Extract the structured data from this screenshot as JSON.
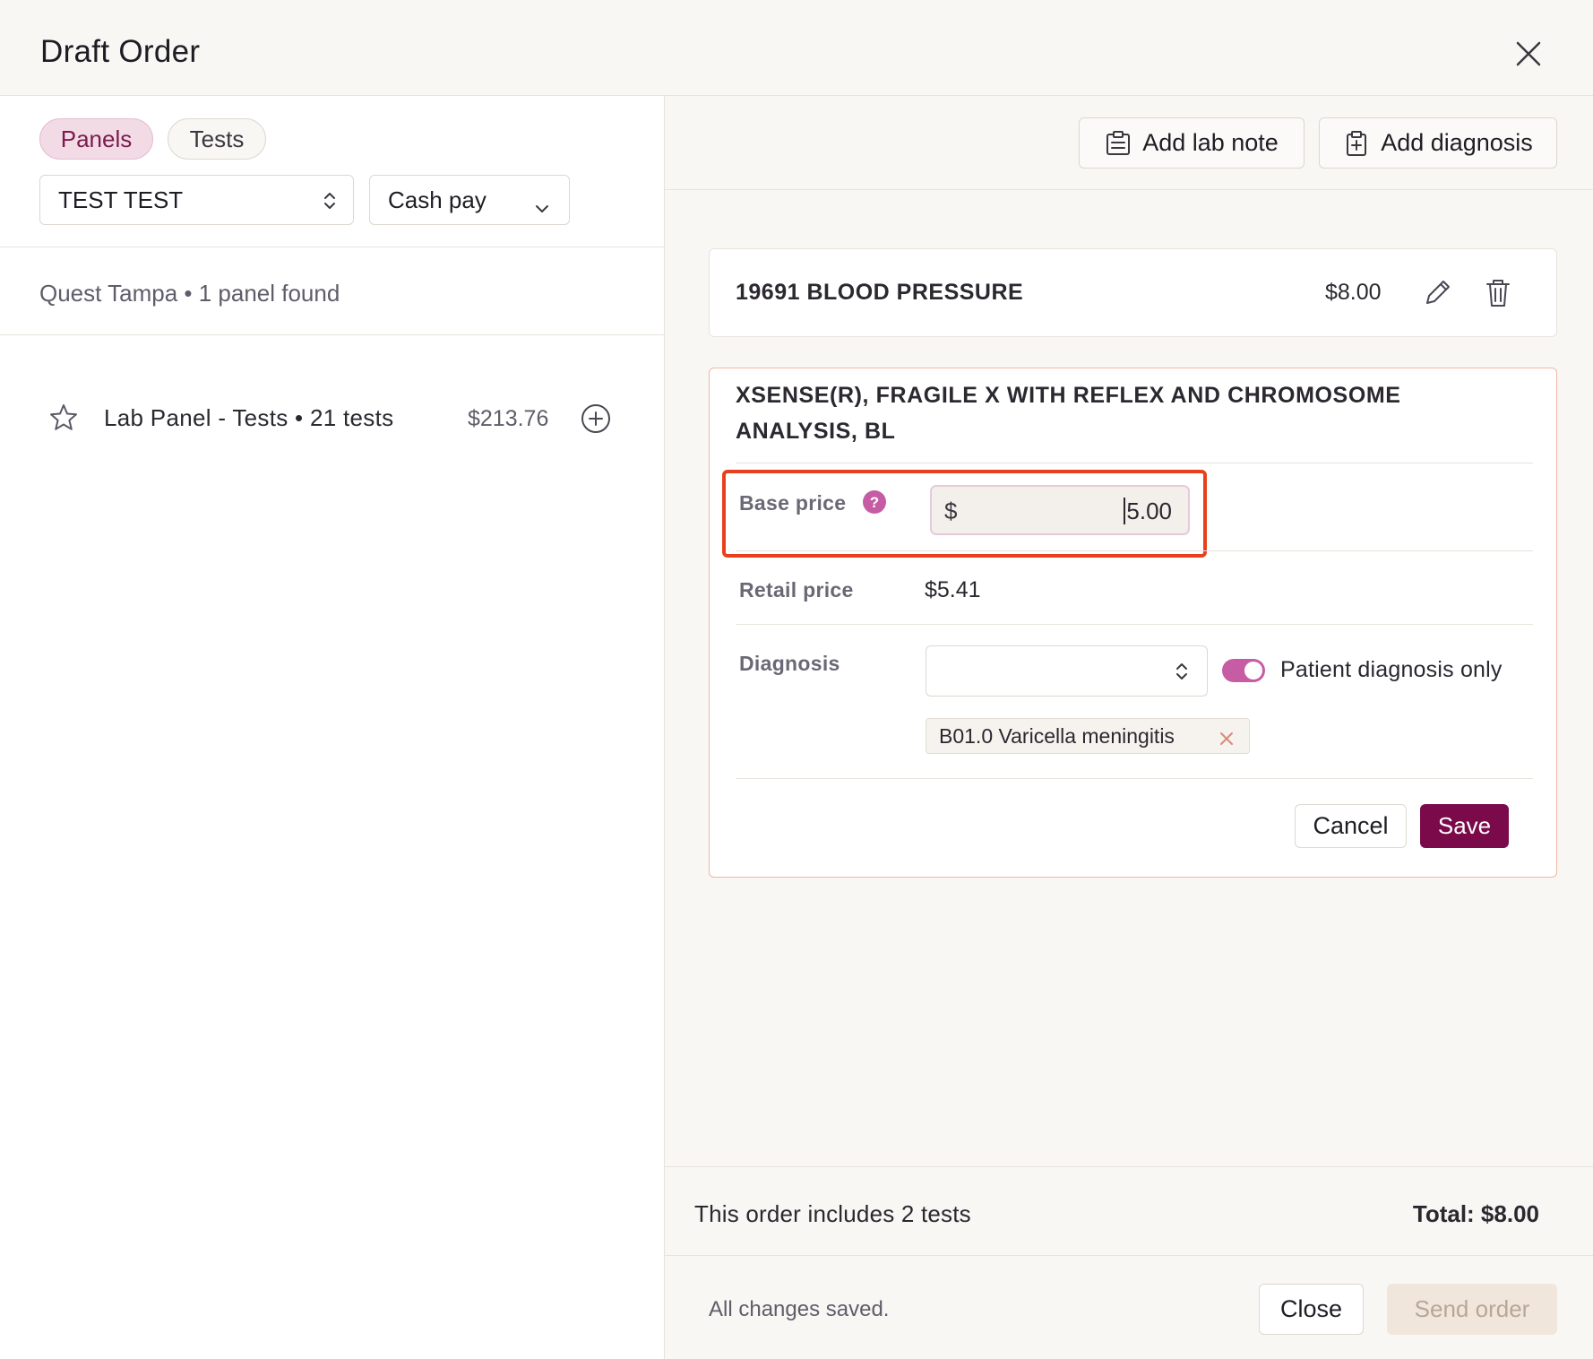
{
  "header": {
    "title": "Draft Order",
    "close_icon": "close-icon"
  },
  "left": {
    "tabs": [
      {
        "label": "Panels",
        "active": true
      },
      {
        "label": "Tests",
        "active": false
      }
    ],
    "patient_select": {
      "value": "TEST TEST"
    },
    "payment_select": {
      "value": "Cash pay"
    },
    "results_summary": "Quest Tampa • 1 panel found",
    "panel": {
      "name": "Lab Panel - Tests • 21 tests",
      "price": "$213.76"
    }
  },
  "right": {
    "toolbar": {
      "add_lab_note": "Add lab note",
      "add_diagnosis": "Add diagnosis"
    },
    "test_item": {
      "name": "19691 BLOOD PRESSURE",
      "price": "$8.00"
    },
    "edit_card": {
      "title_line1": "XSENSE(R), FRAGILE X WITH REFLEX AND CHROMOSOME",
      "title_line2": "ANALYSIS, BL",
      "base_price_label": "Base price",
      "currency_symbol": "$",
      "base_price_value": "5.00",
      "retail_price_label": "Retail price",
      "retail_price_value": "$5.41",
      "diagnosis_label": "Diagnosis",
      "diagnosis_select_value": "",
      "patient_diagnosis_only_label": "Patient diagnosis only",
      "patient_diagnosis_only_on": true,
      "diagnosis_chip": "B01.0 Varicella meningitis",
      "cancel_label": "Cancel",
      "save_label": "Save"
    },
    "summary": {
      "count_text": "This order includes 2 tests",
      "total_text": "Total: $8.00"
    },
    "footer": {
      "status": "All changes saved.",
      "close_label": "Close",
      "send_label": "Send order"
    }
  },
  "colors": {
    "accent": "#7a0a4a",
    "highlight": "#e8401c",
    "toggle": "#c65ca4"
  }
}
